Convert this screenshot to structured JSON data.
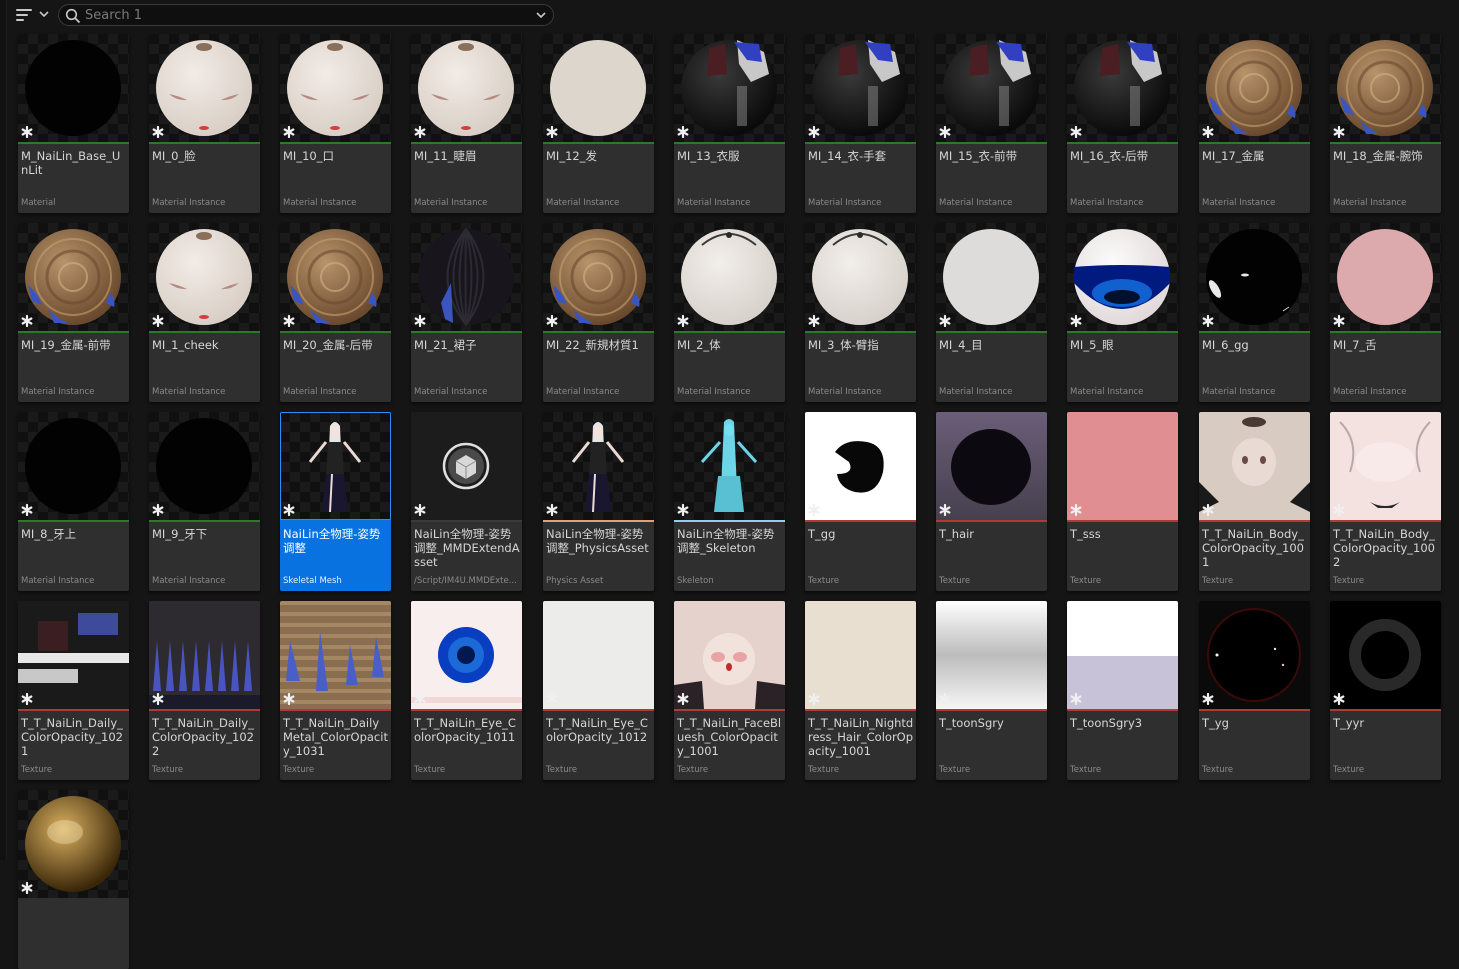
{
  "toolbar": {
    "filter_icon": "filter-icon",
    "search": {
      "placeholder": "Search 1",
      "value": ""
    }
  },
  "colors": {
    "material_bar": "#2f8a2f",
    "mesh_bar": "#d78bd1",
    "physics_bar": "#e6a070",
    "skeleton_bar": "#8fd0e6",
    "texture_bar": "#b03a3a",
    "selection": "#0873e0"
  },
  "assets": [
    {
      "name": "M_NaiLin_Base_UnLit",
      "type": "Material",
      "thumb": "black-sphere",
      "bar": "#2a7a2a"
    },
    {
      "name": "MI_0_脸",
      "type": "Material Instance",
      "thumb": "face-sphere",
      "bar": "#2a7a2a"
    },
    {
      "name": "MI_10_口",
      "type": "Material Instance",
      "thumb": "face-sphere",
      "bar": "#2a7a2a"
    },
    {
      "name": "MI_11_睫眉",
      "type": "Material Instance",
      "thumb": "face-sphere",
      "bar": "#2a7a2a"
    },
    {
      "name": "MI_12_发",
      "type": "Material Instance",
      "thumb": "cream-sphere",
      "bar": "#2a7a2a"
    },
    {
      "name": "MI_13_衣服",
      "type": "Material Instance",
      "thumb": "cloth-sphere",
      "bar": "#2a7a2a"
    },
    {
      "name": "MI_14_衣-手套",
      "type": "Material Instance",
      "thumb": "cloth-sphere",
      "bar": "#2a7a2a"
    },
    {
      "name": "MI_15_衣-前带",
      "type": "Material Instance",
      "thumb": "cloth-sphere",
      "bar": "#2a7a2a"
    },
    {
      "name": "MI_16_衣-后带",
      "type": "Material Instance",
      "thumb": "cloth-sphere",
      "bar": "#2a7a2a"
    },
    {
      "name": "MI_17_金属",
      "type": "Material Instance",
      "thumb": "metal-sphere",
      "bar": "#2a7a2a"
    },
    {
      "name": "MI_18_金属-腕饰",
      "type": "Material Instance",
      "thumb": "metal-sphere",
      "bar": "#2a7a2a"
    },
    {
      "name": "MI_19_金属-前带",
      "type": "Material Instance",
      "thumb": "metal-sphere",
      "bar": "#2a7a2a"
    },
    {
      "name": "MI_1_cheek",
      "type": "Material Instance",
      "thumb": "face-sphere",
      "bar": "#2a7a2a"
    },
    {
      "name": "MI_20_金属-后带",
      "type": "Material Instance",
      "thumb": "metal-sphere",
      "bar": "#2a7a2a"
    },
    {
      "name": "MI_21_裙子",
      "type": "Material Instance",
      "thumb": "skirt-sphere",
      "bar": "#2a7a2a"
    },
    {
      "name": "MI_22_新規材質1",
      "type": "Material Instance",
      "thumb": "metal-sphere",
      "bar": "#2a7a2a"
    },
    {
      "name": "MI_2_体",
      "type": "Material Instance",
      "thumb": "body-sphere",
      "bar": "#2a7a2a"
    },
    {
      "name": "MI_3_体-臂指",
      "type": "Material Instance",
      "thumb": "body-sphere",
      "bar": "#2a7a2a"
    },
    {
      "name": "MI_4_目",
      "type": "Material Instance",
      "thumb": "white-sphere",
      "bar": "#2a7a2a"
    },
    {
      "name": "MI_5_眼",
      "type": "Material Instance",
      "thumb": "eye-sphere",
      "bar": "#2a7a2a"
    },
    {
      "name": "MI_6_gg",
      "type": "Material Instance",
      "thumb": "gg-sphere",
      "bar": "#2a7a2a"
    },
    {
      "name": "MI_7_舌",
      "type": "Material Instance",
      "thumb": "pink-sphere",
      "bar": "#2a7a2a"
    },
    {
      "name": "MI_8_牙上",
      "type": "Material Instance",
      "thumb": "black-sphere",
      "bar": "#2a7a2a"
    },
    {
      "name": "MI_9_牙下",
      "type": "Material Instance",
      "thumb": "black-sphere",
      "bar": "#2a7a2a"
    },
    {
      "name": "NaiLin全物理-姿势调整",
      "type": "Skeletal Mesh",
      "thumb": "figure-dark",
      "bar": "#0873e0",
      "selected": true
    },
    {
      "name": "NaiLin全物理-姿势调整_MMDExtendAsset",
      "type": "/Script/IM4U.MMDExte...",
      "thumb": "cube",
      "bar": "#3a3a3a"
    },
    {
      "name": "NaiLin全物理-姿势调整_PhysicsAsset",
      "type": "Physics Asset",
      "thumb": "figure-dark",
      "bar": "#e6a070"
    },
    {
      "name": "NaiLin全物理-姿势调整_Skeleton",
      "type": "Skeleton",
      "thumb": "figure-cyan",
      "bar": "#8fd0e6"
    },
    {
      "name": "T_gg",
      "type": "Texture",
      "thumb": "tex-gg",
      "bar": "#b03a3a"
    },
    {
      "name": "T_hair",
      "type": "Texture",
      "thumb": "tex-hair",
      "bar": "#b03a3a"
    },
    {
      "name": "T_sss",
      "type": "Texture",
      "thumb": "tex-sss",
      "bar": "#b03a3a"
    },
    {
      "name": "T_T_NaiLin_Body_ColorOpacity_1001",
      "type": "Texture",
      "thumb": "tex-body1",
      "bar": "#b03a3a"
    },
    {
      "name": "T_T_NaiLin_Body_ColorOpacity_1002",
      "type": "Texture",
      "thumb": "tex-body2",
      "bar": "#b03a3a"
    },
    {
      "name": "T_T_NaiLin_Daily_ColorOpacity_1021",
      "type": "Texture",
      "thumb": "tex-daily1",
      "bar": "#b03a3a"
    },
    {
      "name": "T_T_NaiLin_Daily_ColorOpacity_1022",
      "type": "Texture",
      "thumb": "tex-daily2",
      "bar": "#b03a3a"
    },
    {
      "name": "T_T_NaiLin_DailyMetal_ColorOpacity_1031",
      "type": "Texture",
      "thumb": "tex-metal",
      "bar": "#b03a3a"
    },
    {
      "name": "T_T_NaiLin_Eye_ColorOpacity_1011",
      "type": "Texture",
      "thumb": "tex-eye",
      "bar": "#b03a3a"
    },
    {
      "name": "T_T_NaiLin_Eye_ColorOpacity_1012",
      "type": "Texture",
      "thumb": "tex-eye2",
      "bar": "#b03a3a"
    },
    {
      "name": "T_T_NaiLin_FaceBluesh_ColorOpacity_1001",
      "type": "Texture",
      "thumb": "tex-face",
      "bar": "#b03a3a"
    },
    {
      "name": "T_T_NaiLin_Nightdress_Hair_ColorOpacity_1001",
      "type": "Texture",
      "thumb": "tex-beige",
      "bar": "#b03a3a"
    },
    {
      "name": "T_toonSgry",
      "type": "Texture",
      "thumb": "tex-toon1",
      "bar": "#b03a3a"
    },
    {
      "name": "T_toonSgry3",
      "type": "Texture",
      "thumb": "tex-toon3",
      "bar": "#b03a3a"
    },
    {
      "name": "T_yg",
      "type": "Texture",
      "thumb": "tex-yg",
      "bar": "#b03a3a"
    },
    {
      "name": "T_yyr",
      "type": "Texture",
      "thumb": "tex-yyr",
      "bar": "#b03a3a"
    },
    {
      "name": "",
      "type": "",
      "thumb": "gold-sphere",
      "bar": "#2a7a2a"
    }
  ],
  "display_names": [
    "M_NaiLin_Base_Un Lit",
    "MI_0_脸",
    "MI_10_口",
    "MI_11_睫眉",
    "MI_12_发",
    "MI_13_衣服",
    "MI_14_衣-手套",
    "MI_15_衣-前带",
    "MI_16_衣-后带",
    "MI_17_金属",
    "MI_18_金属-腕饰",
    "MI_19_金属-前带",
    "MI_1_cheek",
    "MI_20_金属-后带",
    "MI_21_裙子",
    "MI_22_新規材質1",
    "MI_2_体",
    "MI_3_体-臂指",
    "MI_4_目",
    "MI_5_眼",
    "MI_6_gg",
    "MI_7_舌",
    "MI_8_牙上",
    "MI_9_牙下",
    "NaiLin全物理-姿势\n调整",
    "NaiLin全物理-姿势\n调整_MMDExtend\nAsset",
    "NaiLin全物理-姿势\n调整_PhysicsAsset",
    "NaiLin全物理-姿势\n调整_Skeleton",
    "T_gg",
    "T_hair",
    "T_sss",
    "T_T_NaiLin_Body_\nColorOpacity_1001",
    "T_T_NaiLin_Body_\nColorOpacity_1002",
    "T_T_NaiLin_Daily_\nColorOpacity_1021",
    "T_T_NaiLin_Daily_\nColorOpacity_1022",
    "T_T_NaiLin_Daily\nMetal_ColorOpacity\n_1031",
    "T_T_NaiLin_Eye_\nColorOpacity_1011",
    "T_T_NaiLin_Eye_\nColorOpacity_1012",
    "T_T_NaiLin_Face\nBluesh_Color\nOpacity_1001",
    "T_T_NaiLin_\nNightdress_Hair_\nColorOpacity_1001",
    "T_toonSgry",
    "T_toonSgry3",
    "T_yg",
    "T_yyr",
    ""
  ]
}
